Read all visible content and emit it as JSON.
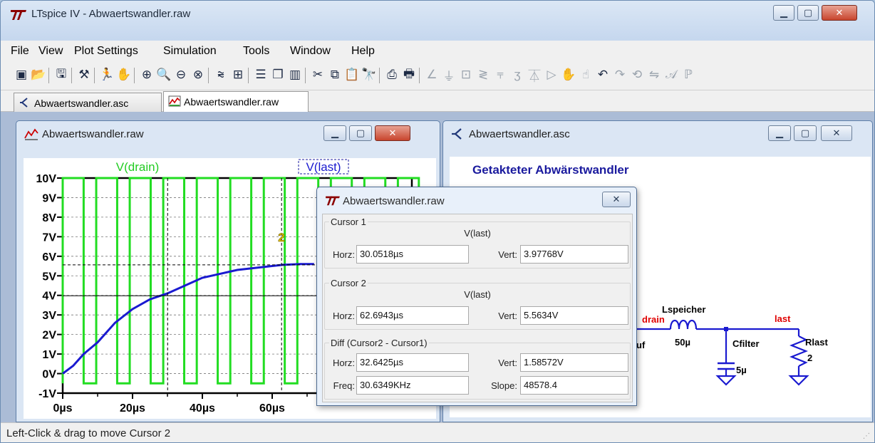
{
  "window": {
    "title": "LTspice IV - Abwaertswandler.raw",
    "minimize": "▁",
    "maximize": "▢",
    "close": "✕"
  },
  "menu": [
    {
      "label": "File",
      "key": "F"
    },
    {
      "label": "View",
      "key": "V"
    },
    {
      "label": "Plot Settings",
      "key": "P"
    },
    {
      "label": "Simulation",
      "key": "S"
    },
    {
      "label": "Tools",
      "key": "T"
    },
    {
      "label": "Window",
      "key": "W"
    },
    {
      "label": "Help",
      "key": "H"
    }
  ],
  "toolbar": {
    "icons": [
      "new-schematic-icon",
      "open-icon",
      "save-icon",
      "control-panel-icon",
      "run-icon",
      "halt-icon",
      "zoom-in-icon",
      "zoom-area-icon",
      "zoom-out-icon",
      "zoom-cancel-icon",
      "autorange-icon",
      "plot-setup-icon",
      "tile-horizontal-icon",
      "cascade-icon",
      "tile-vertical-icon",
      "cut-icon",
      "copy-icon",
      "paste-icon",
      "find-icon",
      "print-preview-icon",
      "print-icon",
      "draw-wire-icon",
      "ground-icon",
      "label-net-icon",
      "resistor-icon",
      "capacitor-icon",
      "inductor-icon",
      "diode-icon",
      "component-icon",
      "move-icon",
      "drag-icon",
      "undo-icon",
      "redo-icon",
      "rotate-icon",
      "mirror-icon",
      "text-icon",
      "spice-directive-icon"
    ]
  },
  "tabs": [
    {
      "label": "Abwaertswandler.asc",
      "active": false
    },
    {
      "label": "Abwaertswandler.raw",
      "active": true
    }
  ],
  "plot_window": {
    "title": "Abwaertswandler.raw",
    "trace_labels": [
      "V(drain)",
      "V(last)"
    ],
    "cursor_marker": "2"
  },
  "schematic_window": {
    "title": "Abwaertswandler.asc",
    "heading": "Getakteter Abwärstwandler",
    "labels": {
      "drain_net": "drain",
      "inductor_name": "Lspeicher",
      "inductor_value": "50µ",
      "cap_name": "Cfilter",
      "cap_value": "5µ",
      "load_net": "last",
      "res_name": "Rlast",
      "res_value": "2",
      "partial_left": "uf"
    }
  },
  "cursor_dialog": {
    "title": "Abwaertswandler.raw",
    "cursor1": {
      "group": "Cursor 1",
      "trace": "V(last)",
      "horz_label": "Horz:",
      "horz": "30.0518µs",
      "vert_label": "Vert:",
      "vert": "3.97768V"
    },
    "cursor2": {
      "group": "Cursor 2",
      "trace": "V(last)",
      "horz_label": "Horz:",
      "horz": "62.6943µs",
      "vert_label": "Vert:",
      "vert": "5.5634V"
    },
    "diff": {
      "group": "Diff (Cursor2 - Cursor1)",
      "horz_label": "Horz:",
      "horz": "32.6425µs",
      "vert_label": "Vert:",
      "vert": "1.58572V",
      "freq_label": "Freq:",
      "freq": "30.6349KHz",
      "slope_label": "Slope:",
      "slope": "48578.4"
    }
  },
  "status": {
    "text": "Left-Click & drag to move Cursor 2"
  },
  "chart_data": {
    "type": "line",
    "title": "",
    "xlabel": "",
    "ylabel": "",
    "x_ticks": [
      "0µs",
      "20µs",
      "40µs",
      "60µs"
    ],
    "y_ticks": [
      "10V",
      "9V",
      "8V",
      "7V",
      "6V",
      "5V",
      "4V",
      "3V",
      "2V",
      "1V",
      "0V",
      "-1V"
    ],
    "xlim": [
      0,
      100
    ],
    "ylim": [
      -1,
      10
    ],
    "grid": true,
    "series": [
      {
        "name": "V(drain)",
        "color": "#22dd22",
        "kind": "pwm",
        "period_us": 9.6,
        "high_us": 6.0,
        "high": 10,
        "low": -0.5,
        "cycles": 11
      },
      {
        "name": "V(last)",
        "color": "#1a1ad0",
        "x": [
          0,
          3,
          6,
          10,
          15,
          20,
          25,
          30,
          35,
          40,
          45,
          50,
          55,
          60,
          63,
          68,
          72
        ],
        "y": [
          0,
          0.4,
          1.0,
          1.6,
          2.6,
          3.3,
          3.8,
          4.1,
          4.5,
          4.9,
          5.1,
          5.3,
          5.4,
          5.5,
          5.56,
          5.6,
          5.6
        ]
      }
    ],
    "cursors": [
      {
        "x": 30.05,
        "y": 3.98,
        "style": "dashed-vertical"
      },
      {
        "x": 62.69,
        "y": 5.56,
        "style": "dashed-vertical"
      }
    ]
  }
}
